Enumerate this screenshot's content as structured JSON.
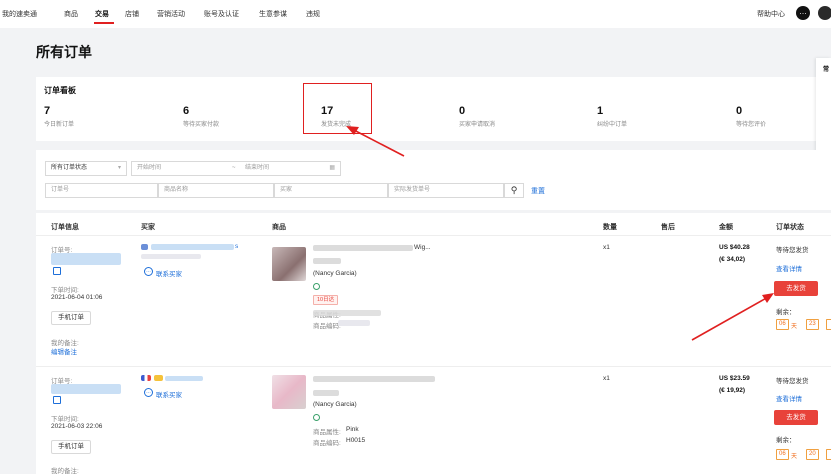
{
  "topnav": {
    "items": [
      "我的速卖通",
      "商品",
      "交易",
      "店铺",
      "营销活动",
      "账号及认证",
      "生意参谋",
      "违规"
    ],
    "help": "帮助中心"
  },
  "page": {
    "title": "所有订单"
  },
  "board": {
    "title": "订单看板",
    "stats": [
      {
        "num": "7",
        "label": "今日新订单"
      },
      {
        "num": "6",
        "label": "等待买家付款"
      },
      {
        "num": "17",
        "label": "发货未完成"
      },
      {
        "num": "0",
        "label": "买家申请取消"
      },
      {
        "num": "1",
        "label": "纠纷中订单"
      },
      {
        "num": "0",
        "label": "等待您评价"
      }
    ]
  },
  "side_panel": {
    "label": "常"
  },
  "filters": {
    "status": "所有订单状态",
    "start_time": "开始时间",
    "separator": "~",
    "end_time": "结束时间",
    "order_no": "订单号",
    "product_name": "商品名称",
    "buyer": "买家",
    "tracking_no": "实际发货单号",
    "search_icon": "search-icon",
    "reset": "重置"
  },
  "table": {
    "headers": [
      "订单信息",
      "买家",
      "商品",
      "数量",
      "售后",
      "金额",
      "订单状态"
    ]
  },
  "orders": [
    {
      "order_no_label": "订单号:",
      "order_time_label": "下单时间:",
      "order_time": "2021-06-04 01:06",
      "source_tag": "手机订单",
      "note_label": "我的备注:",
      "edit_note": "编辑备注",
      "buyer_suffix": "s",
      "contact": "联系买家",
      "product_title_suffix": "Wig...",
      "product_buyer": "(Nancy Garcia)",
      "deadline_tag": "10日达",
      "attr_label": "商品属性:",
      "sku_label": "商品编码:",
      "qty": "x1",
      "amount": "US $40.28",
      "amount_local": "(€ 34,02)",
      "status": "等待您发货",
      "view_detail": "查看详情",
      "ship_button": "去发货",
      "remaining_label": "剩余：",
      "remaining_days": "06",
      "day_unit": "天",
      "remaining_hours": "23"
    },
    {
      "order_no_label": "订单号:",
      "order_time_label": "下单时间:",
      "order_time": "2021-06-03 22:06",
      "source_tag": "手机订单",
      "note_label": "我的备注:",
      "contact": "联系买家",
      "product_buyer": "(Nancy Garcia)",
      "attr_label": "商品属性:",
      "attr_value": "Pink",
      "sku_label": "商品编码:",
      "sku_value": "H0015",
      "qty": "x1",
      "amount": "US $23.59",
      "amount_local": "(€ 19,92)",
      "status": "等待您发货",
      "view_detail": "查看详情",
      "ship_button": "去发货",
      "remaining_label": "剩余：",
      "remaining_days": "06",
      "day_unit": "天",
      "remaining_hours": "20"
    }
  ],
  "colors": {
    "accent": "#e02020",
    "link": "#1e6fd9",
    "ship_button": "#e8423a",
    "countdown": "#f07020"
  }
}
